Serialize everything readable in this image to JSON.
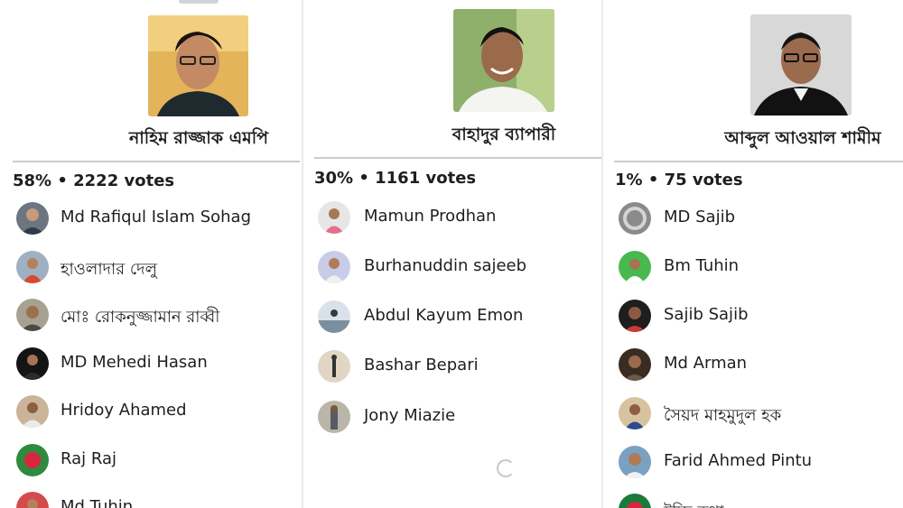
{
  "columns": [
    {
      "candidate": "নাহিম রাজ্জাক এমপি",
      "summary": "58% • 2222 votes",
      "voters": [
        "Md Rafiqul Islam Sohag",
        "হাওলাদার দেলু",
        "মোঃ রোকনুজ্জামান রাব্বী",
        "MD Mehedi Hasan",
        "Hridoy Ahamed",
        "Raj Raj",
        "Md Tuhin"
      ]
    },
    {
      "candidate": "বাহাদুর ব্যাপারী",
      "summary": "30% • 1161 votes",
      "voters": [
        "Mamun Prodhan",
        "Burhanuddin sajeeb",
        "Abdul Kayum Emon",
        "Bashar Bepari",
        "Jony Miazie"
      ]
    },
    {
      "candidate": "আব্দুল আওয়াল শামীম",
      "summary": "1% • 75 votes",
      "voters": [
        "MD Sajib",
        "Bm Tuhin",
        "Sajib Sajib",
        "Md Arman",
        "সৈয়দ মাহমুদুল হক",
        "Farid Ahmed Pintu",
        "ইচ্ছি কথা"
      ]
    }
  ],
  "colors": {
    "background": "#ffffff",
    "text": "#1c1e21",
    "divider": "#c8ccd1"
  }
}
